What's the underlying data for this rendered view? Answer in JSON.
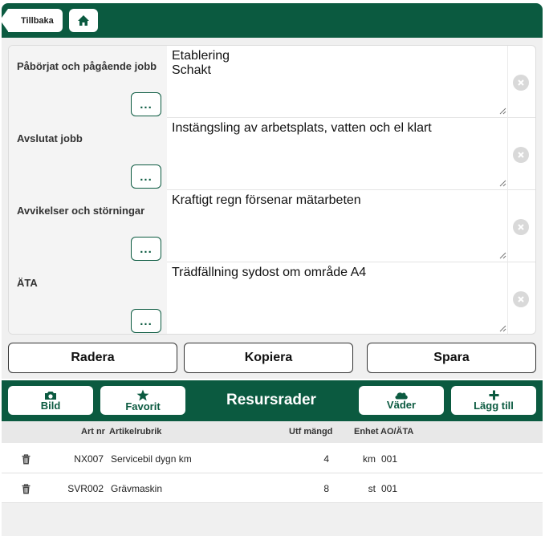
{
  "topbar": {
    "back_label": "Tillbaka"
  },
  "fields": [
    {
      "label": "Påbörjat och pågående jobb",
      "value": "Etablering\nSchakt",
      "dots": "..."
    },
    {
      "label": "Avslutat jobb",
      "value": "Instängsling av arbetsplats, vatten och el klart",
      "dots": "..."
    },
    {
      "label": "Avvikelser och störningar",
      "value": "Kraftigt regn försenar mätarbeten",
      "dots": "..."
    },
    {
      "label": "ÄTA",
      "value": "Trädfällning sydost om område A4",
      "dots": "..."
    }
  ],
  "actions": {
    "delete": "Radera",
    "copy": "Kopiera",
    "save": "Spara"
  },
  "resources": {
    "title": "Resursrader",
    "photo": "Bild",
    "favorite": "Favorit",
    "weather": "Väder",
    "add": "Lägg till"
  },
  "table": {
    "headers": {
      "art_nr": "Art nr",
      "article": "Artikelrubrik",
      "qty": "Utf mängd",
      "unit": "Enhet",
      "ao": "AO/ÄTA"
    },
    "rows": [
      {
        "art_nr": "NX007",
        "article": "Servicebil dygn km",
        "qty": "4",
        "unit": "km",
        "ao": "001"
      },
      {
        "art_nr": "SVR002",
        "article": "Grävmaskin",
        "qty": "8",
        "unit": "st",
        "ao": "001"
      }
    ]
  },
  "colors": {
    "brand": "#0b5a40"
  }
}
